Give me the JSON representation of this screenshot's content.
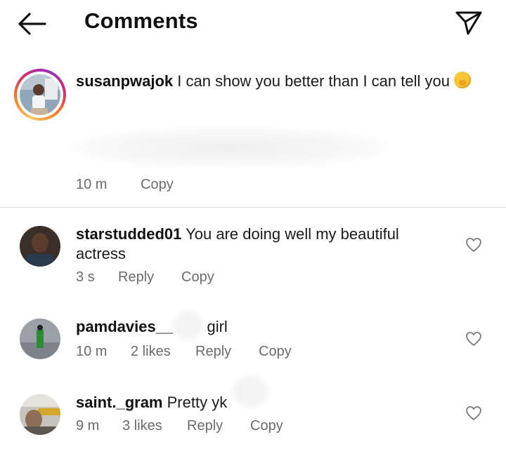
{
  "header": {
    "title": "Comments",
    "back_icon": "arrow-left-icon",
    "share_icon": "paper-plane-icon"
  },
  "caption": {
    "username": "susanpwajok",
    "text": "I can show you better than I can tell you",
    "emoji": "face-with-hand-over-mouth-emoji",
    "time": "10 m",
    "copy_label": "Copy"
  },
  "comments": [
    {
      "username": "starstudded01",
      "text": "You are doing well my beautiful actress",
      "time": "3 s",
      "likes": "",
      "reply_label": "Reply",
      "copy_label": "Copy"
    },
    {
      "username": "pamdavies__",
      "text": "girl",
      "time": "10 m",
      "likes": "2 likes",
      "reply_label": "Reply",
      "copy_label": "Copy"
    },
    {
      "username": "saint._gram",
      "text": "Pretty yk",
      "time": "9 m",
      "likes": "3 likes",
      "reply_label": "Reply",
      "copy_label": "Copy"
    }
  ],
  "colors": {
    "text": "#111111",
    "meta": "#6b6b6b",
    "divider": "#d9d9d9",
    "story_ring": [
      "#fdc468",
      "#fa7e1e",
      "#d62976",
      "#962fbf"
    ]
  }
}
